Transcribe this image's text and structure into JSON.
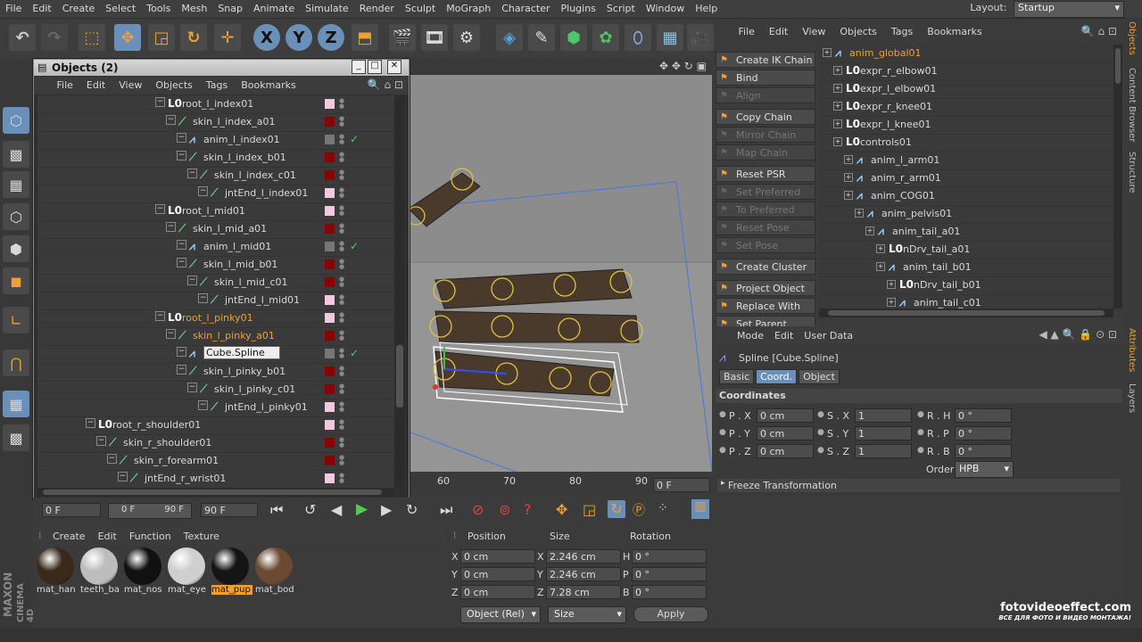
{
  "menubar": {
    "items": [
      "File",
      "Edit",
      "Create",
      "Select",
      "Tools",
      "Mesh",
      "Snap",
      "Animate",
      "Simulate",
      "Render",
      "Sculpt",
      "MoGraph",
      "Character",
      "Plugins",
      "Script",
      "Window",
      "Help"
    ],
    "layout_label": "Layout:",
    "layout_value": "Startup"
  },
  "toolbar": {
    "x_label": "X",
    "y_label": "Y",
    "z_label": "Z"
  },
  "object_manager": {
    "title": "Objects (2)",
    "menu": [
      "File",
      "Edit",
      "View",
      "Objects",
      "Tags",
      "Bookmarks"
    ],
    "rows": [
      {
        "label": "root_l_index01",
        "type": "null",
        "indent": 150,
        "tag": "#f0c8e0",
        "highlight": false
      },
      {
        "label": "skin_l_index_a01",
        "type": "bone",
        "indent": 162,
        "tag": "#8b0000",
        "highlight": false
      },
      {
        "label": "anim_l_index01",
        "type": "spline",
        "indent": 174,
        "tag": "#777",
        "check": true,
        "highlight": false
      },
      {
        "label": "skin_l_index_b01",
        "type": "bone",
        "indent": 174,
        "tag": "#8b0000",
        "highlight": false
      },
      {
        "label": "skin_l_index_c01",
        "type": "bone",
        "indent": 186,
        "tag": "#8b0000",
        "highlight": false
      },
      {
        "label": "jntEnd_l_index01",
        "type": "bone",
        "indent": 198,
        "tag": "#f0c8e0",
        "highlight": false
      },
      {
        "label": "root_l_mid01",
        "type": "null",
        "indent": 150,
        "tag": "#f0c8e0",
        "highlight": false
      },
      {
        "label": "skin_l_mid_a01",
        "type": "bone",
        "indent": 162,
        "tag": "#8b0000",
        "highlight": false
      },
      {
        "label": "anim_l_mid01",
        "type": "spline",
        "indent": 174,
        "tag": "#777",
        "check": true,
        "highlight": false
      },
      {
        "label": "skin_l_mid_b01",
        "type": "bone",
        "indent": 174,
        "tag": "#8b0000",
        "highlight": false
      },
      {
        "label": "skin_l_mid_c01",
        "type": "bone",
        "indent": 186,
        "tag": "#8b0000",
        "highlight": false
      },
      {
        "label": "jntEnd_l_mid01",
        "type": "bone",
        "indent": 198,
        "tag": "#f0c8e0",
        "highlight": false
      },
      {
        "label": "root_l_pinky01",
        "type": "null",
        "indent": 150,
        "tag": "#f0c8e0",
        "highlight": true
      },
      {
        "label": "skin_l_pinky_a01",
        "type": "bone",
        "indent": 162,
        "tag": "#8b0000",
        "highlight": true
      },
      {
        "label": "Cube.Spline",
        "type": "spline",
        "indent": 174,
        "tag": "#777",
        "check": true,
        "editing": true,
        "highlight": false
      },
      {
        "label": "skin_l_pinky_b01",
        "type": "bone",
        "indent": 174,
        "tag": "#8b0000",
        "highlight": false
      },
      {
        "label": "skin_l_pinky_c01",
        "type": "bone",
        "indent": 186,
        "tag": "#8b0000",
        "highlight": false
      },
      {
        "label": "jntEnd_l_pinky01",
        "type": "bone",
        "indent": 198,
        "tag": "#f0c8e0",
        "highlight": false
      },
      {
        "label": "root_r_shoulder01",
        "type": "null",
        "indent": 72,
        "tag": "#f0c8e0",
        "highlight": false
      },
      {
        "label": "skin_r_shoulder01",
        "type": "bone",
        "indent": 84,
        "tag": "#8b0000",
        "highlight": false
      },
      {
        "label": "skin_r_forearm01",
        "type": "bone",
        "indent": 96,
        "tag": "#8b0000",
        "highlight": false
      },
      {
        "label": "jntEnd_r_wrist01",
        "type": "bone",
        "indent": 108,
        "tag": "#f0c8e0",
        "highlight": false
      }
    ]
  },
  "timeline": {
    "ticks": [
      "60",
      "70",
      "80",
      "90"
    ],
    "frame_right": "0 F"
  },
  "controls": {
    "frame_start": "0 F",
    "range_left": "0 F",
    "range_right": "90 F",
    "frame_end": "90 F"
  },
  "materials": {
    "menu": [
      "Create",
      "Edit",
      "Function",
      "Texture"
    ],
    "items": [
      {
        "label": "mat_han",
        "color": "#3a2a1c"
      },
      {
        "label": "teeth_ba",
        "color": "#bdbdbd"
      },
      {
        "label": "mat_nos",
        "color": "#111111"
      },
      {
        "label": "mat_eye",
        "color": "#cfcfcf"
      },
      {
        "label": "mat_pup",
        "color": "#151515",
        "selected": true
      },
      {
        "label": "mat_bod",
        "color": "#6a4a33"
      }
    ]
  },
  "coords": {
    "headers": [
      "Position",
      "Size",
      "Rotation"
    ],
    "rows": [
      {
        "axis": "X",
        "pos": "0 cm",
        "saxis": "X",
        "size": "2.246 cm",
        "raxis": "H",
        "rot": "0 °"
      },
      {
        "axis": "Y",
        "pos": "0 cm",
        "saxis": "Y",
        "size": "2.246 cm",
        "raxis": "P",
        "rot": "0 °"
      },
      {
        "axis": "Z",
        "pos": "0 cm",
        "saxis": "Z",
        "size": "7.28 cm",
        "raxis": "B",
        "rot": "0 °"
      }
    ],
    "mode1": "Object (Rel)",
    "mode2": "Size",
    "apply": "Apply"
  },
  "character": {
    "buttons": [
      {
        "label": "Create IK Chain",
        "enabled": true
      },
      {
        "label": "Bind",
        "enabled": true
      },
      {
        "label": "Align",
        "enabled": false
      },
      {
        "label": "Copy Chain",
        "enabled": true
      },
      {
        "label": "Mirror Chain",
        "enabled": false
      },
      {
        "label": "Map Chain",
        "enabled": false
      },
      {
        "label": "Reset PSR",
        "enabled": true
      },
      {
        "label": "Set Preferred",
        "enabled": false
      },
      {
        "label": "To Preferred",
        "enabled": false
      },
      {
        "label": "Reset Pose",
        "enabled": false
      },
      {
        "label": "Set Pose",
        "enabled": false
      },
      {
        "label": "Create Cluster",
        "enabled": true
      },
      {
        "label": "Project Object",
        "enabled": true
      },
      {
        "label": "Replace With",
        "enabled": true
      },
      {
        "label": "Set Parent",
        "enabled": true
      }
    ]
  },
  "hierarchy": {
    "menu": [
      "File",
      "Edit",
      "View",
      "Objects",
      "Tags",
      "Bookmarks"
    ],
    "rows": [
      {
        "label": "anim_global01",
        "type": "spline",
        "indent": 18,
        "highlight": true
      },
      {
        "label": "expr_r_elbow01",
        "type": "null",
        "indent": 30
      },
      {
        "label": "expr_l_elbow01",
        "type": "null",
        "indent": 30
      },
      {
        "label": "expr_r_knee01",
        "type": "null",
        "indent": 30
      },
      {
        "label": "expr_l_knee01",
        "type": "null",
        "indent": 30
      },
      {
        "label": "controls01",
        "type": "null",
        "indent": 30
      },
      {
        "label": "anim_l_arm01",
        "type": "spline",
        "indent": 42
      },
      {
        "label": "anim_r_arm01",
        "type": "spline",
        "indent": 42
      },
      {
        "label": "anim_COG01",
        "type": "spline",
        "indent": 42
      },
      {
        "label": "anim_pelvis01",
        "type": "spline",
        "indent": 54
      },
      {
        "label": "anim_tail_a01",
        "type": "spline",
        "indent": 66
      },
      {
        "label": "nDrv_tail_a01",
        "type": "null",
        "indent": 78
      },
      {
        "label": "anim_tail_b01",
        "type": "spline",
        "indent": 78
      },
      {
        "label": "nDrv_tail_b01",
        "type": "null",
        "indent": 90
      },
      {
        "label": "anim_tail_c01",
        "type": "spline",
        "indent": 90
      }
    ]
  },
  "attributes": {
    "menu": [
      "Mode",
      "Edit",
      "User Data"
    ],
    "object_title": "Spline [Cube.Spline]",
    "tabs": [
      {
        "label": "Basic",
        "active": false
      },
      {
        "label": "Coord.",
        "active": true
      },
      {
        "label": "Object",
        "active": false
      }
    ],
    "section": "Coordinates",
    "fields": [
      {
        "p": "P . X",
        "pv": "0 cm",
        "s": "S . X",
        "sv": "1",
        "r": "R . H",
        "rv": "0 °"
      },
      {
        "p": "P . Y",
        "pv": "0 cm",
        "s": "S . Y",
        "sv": "1",
        "r": "R . P",
        "rv": "0 °"
      },
      {
        "p": "P . Z",
        "pv": "0 cm",
        "s": "S . Z",
        "sv": "1",
        "r": "R . B",
        "rv": "0 °"
      }
    ],
    "order_label": "Order",
    "order_value": "HPB",
    "freeze": "Freeze Transformation"
  },
  "sidetabs": [
    "Objects",
    "Content Browser",
    "Structure",
    "Attributes",
    "Layers"
  ],
  "watermark": {
    "line1": "fotovideoeffect.com",
    "line2": "ВСЕ ДЛЯ ФОТО И ВИДЕО МОНТАЖА!"
  },
  "brand": {
    "line1": "MAXON",
    "line2": "CINEMA 4D"
  }
}
